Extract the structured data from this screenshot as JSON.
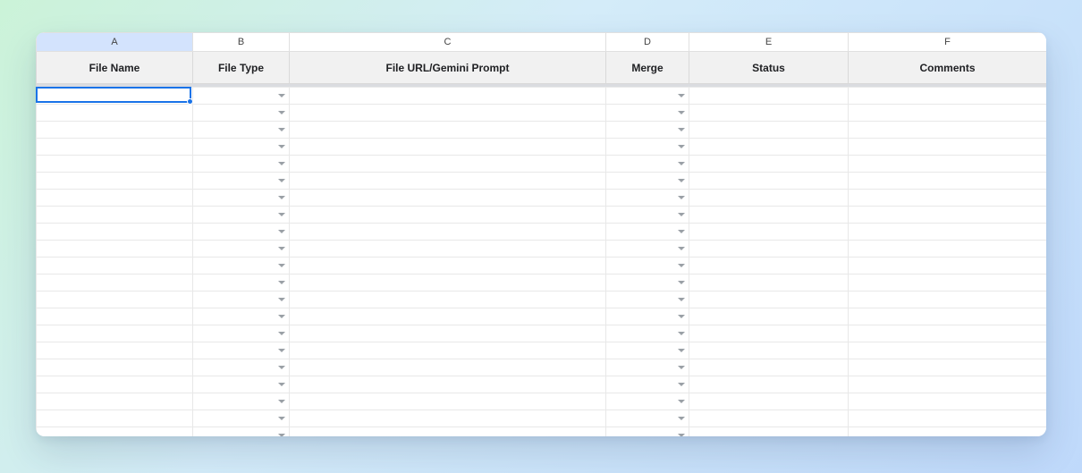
{
  "columns": [
    {
      "letter": "A",
      "label": "File Name",
      "selected": true,
      "hasDropdown": false
    },
    {
      "letter": "B",
      "label": "File Type",
      "selected": false,
      "hasDropdown": true
    },
    {
      "letter": "C",
      "label": "File URL/Gemini Prompt",
      "selected": false,
      "hasDropdown": false
    },
    {
      "letter": "D",
      "label": "Merge",
      "selected": false,
      "hasDropdown": true
    },
    {
      "letter": "E",
      "label": "Status",
      "selected": false,
      "hasDropdown": false
    },
    {
      "letter": "F",
      "label": "Comments",
      "selected": false,
      "hasDropdown": false
    }
  ],
  "visible_data_rows": 21,
  "selected_cell": {
    "row": 0,
    "col": 0
  }
}
